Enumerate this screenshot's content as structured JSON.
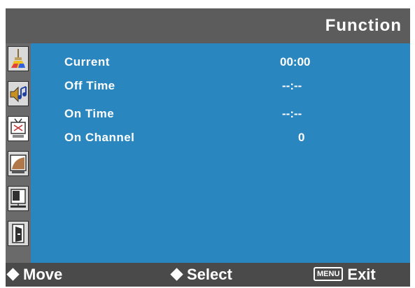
{
  "header": {
    "title": "Function"
  },
  "sidebar": {
    "items": [
      {
        "icon": "brush-color-icon",
        "active": false
      },
      {
        "icon": "speaker-music-icon",
        "active": false
      },
      {
        "icon": "tv-clock-icon",
        "active": true
      },
      {
        "icon": "picture-adjust-icon",
        "active": false
      },
      {
        "icon": "screen-position-icon",
        "active": false
      },
      {
        "icon": "exit-door-icon",
        "active": false
      }
    ]
  },
  "menu": {
    "rows": [
      {
        "label": "Current",
        "value": "00:00"
      },
      {
        "label": "Off Time",
        "value": "--:--"
      },
      {
        "label": "On Time",
        "value": "--:--"
      },
      {
        "label": "On Channel",
        "value": "0"
      }
    ]
  },
  "footer": {
    "move": "Move",
    "select": "Select",
    "menu_key": "MENU",
    "exit": "Exit"
  },
  "colors": {
    "main_bg": "#2a86bf",
    "title_bg": "#5c5c5c",
    "footer_bg": "#4a4a4a"
  }
}
